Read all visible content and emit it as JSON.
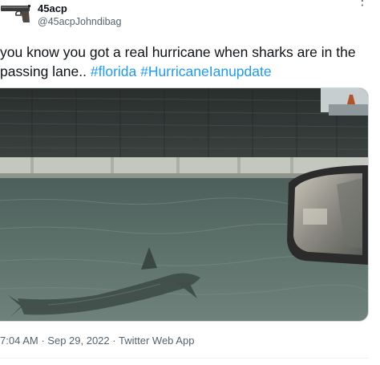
{
  "author": {
    "display_name": "45acp",
    "handle": "@45acpJohndibag",
    "avatar_icon": "pistol-icon"
  },
  "more_menu": "⋮",
  "tweet": {
    "text_plain": "you know you got a real hurricane when sharks are in the passing lane..",
    "hashtags": [
      "#florida",
      "#HurricaneIanupdate"
    ]
  },
  "media": {
    "kind": "photo"
  },
  "meta": {
    "time": "7:04 AM",
    "separator": "·",
    "date": "Sep 29, 2022",
    "source": "Twitter Web App"
  },
  "colors": {
    "text": "#0f1419",
    "secondary": "#536471",
    "link": "#1d9bf0",
    "border": "#cfd9de"
  }
}
